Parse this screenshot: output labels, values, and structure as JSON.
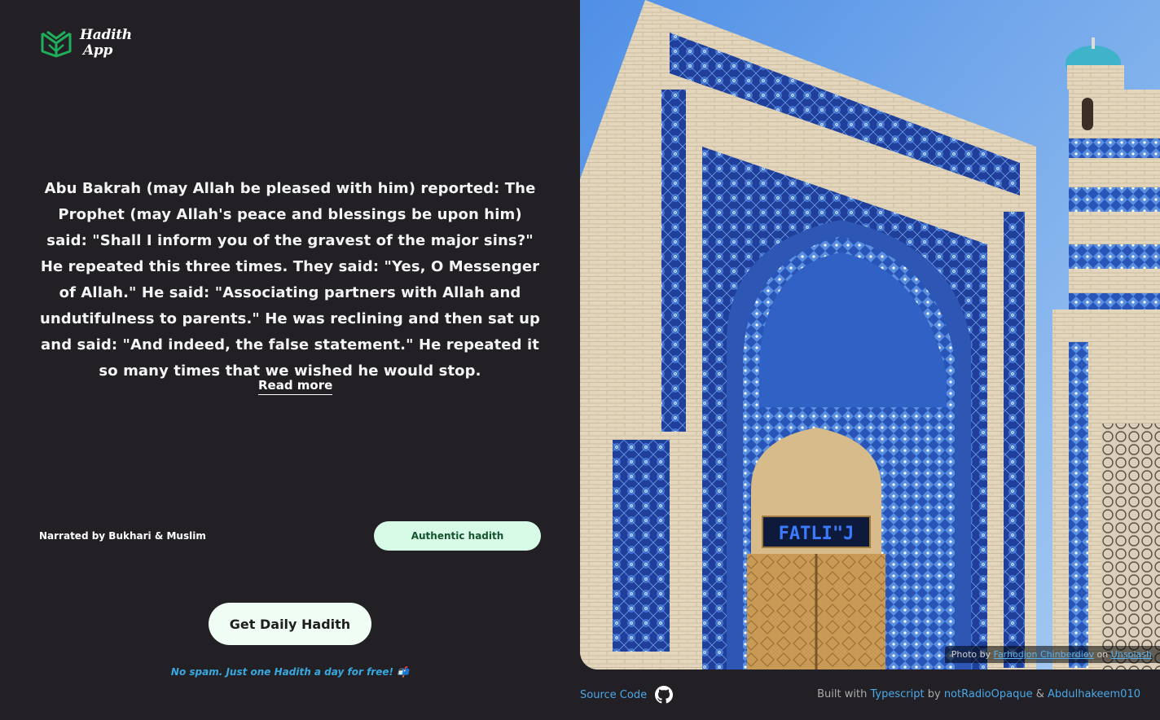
{
  "brand": {
    "line1": "Hadith",
    "line2": "App",
    "accent": "#1fae5b"
  },
  "hadith": {
    "text": "Abu Bakrah (may Allah be pleased with him) reported: The Prophet (may Allah's peace and blessings be upon him) said: \"Shall I inform you of the gravest of the major sins?\" He repeated this three times. They said: \"Yes, O Messenger of Allah.\" He said: \"Associating partners with Allah and undutifulness to parents.\" He was reclining and then sat up and said: \"And indeed, the false statement.\" He repeated it so many times that we wished he would stop.",
    "read_more": "Read more",
    "narrated_by": "Narrated by Bukhari & Muslim",
    "grade": "Authentic hadith",
    "grade_bg": "#d8fbe8"
  },
  "cta": {
    "label": "Get Daily Hadith",
    "note": "No spam. Just one Hadith a day for free! 📬"
  },
  "photo": {
    "credit_prefix": "Photo by",
    "author": "Farhodjon Chinberdiev",
    "on": "on",
    "source": "Unsplash",
    "sign_text": "FATLI\"J"
  },
  "footer": {
    "source_code": "Source Code",
    "github_icon": "github-icon",
    "built_with": "Built with",
    "typescript": "Typescript",
    "by": "by",
    "author1": "notRadioOpaque",
    "amp": "&",
    "author2": "Abdulhakeem010",
    "link_color": "#4aa8e8"
  }
}
